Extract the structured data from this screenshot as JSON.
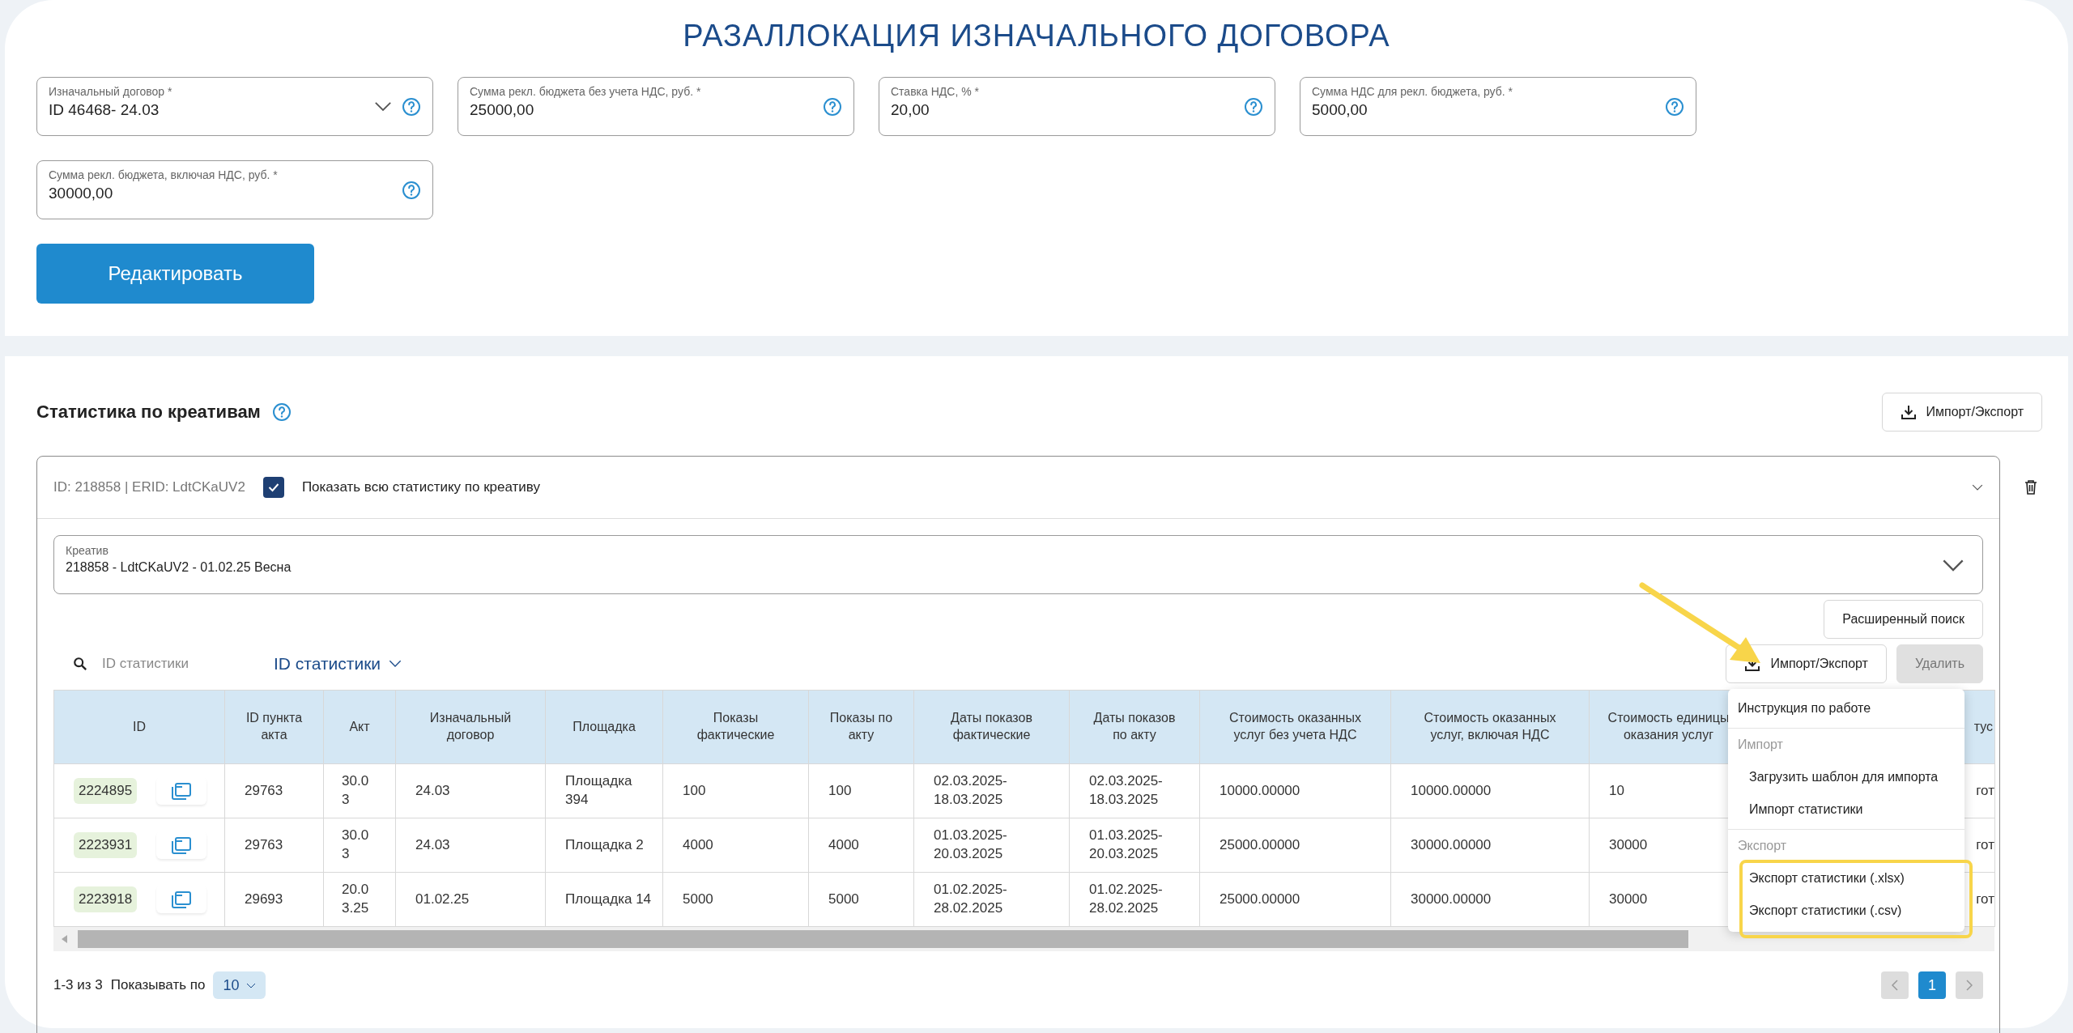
{
  "title": "РАЗАЛЛОКАЦИЯ ИЗНАЧАЛЬНОГО ДОГОВОРА",
  "form_fields": [
    {
      "kind": "select",
      "label": "Изначальный договор *",
      "value": "ID 46468- 24.03"
    },
    {
      "kind": "input",
      "label": "Сумма рекл. бюджета без учета НДС, руб. *",
      "value": "25000,00"
    },
    {
      "kind": "input",
      "label": "Ставка НДС, % *",
      "value": "20,00"
    },
    {
      "kind": "input",
      "label": "Сумма НДС для рекл. бюджета, руб. *",
      "value": "5000,00"
    },
    {
      "kind": "input",
      "label": "Сумма рекл. бюджета, включая НДС, руб. *",
      "value": "30000,00"
    }
  ],
  "edit_button": "Редактировать",
  "stats": {
    "title": "Статистика по креативам",
    "import_export_button": "Импорт/Экспорт",
    "panel": {
      "header": "ID: 218858 | ERID: LdtCKaUV2",
      "show_all": {
        "label": "Показать всю статистику по креативу",
        "checked": true
      },
      "creative_select": {
        "label": "Креатив",
        "value": "218858 - LdtCKaUV2 - 01.02.25 Весна"
      },
      "advanced_search_button": "Расширенный поиск",
      "search": {
        "placeholder": "ID статистики"
      },
      "search_by": "ID статистики",
      "import_export_button": "Импорт/Экспорт",
      "delete_button": {
        "label": "Удалить",
        "disabled": true
      },
      "table": {
        "columns": [
          "ID",
          "ID пункта акта",
          "Акт",
          "Изначальный договор",
          "Площадка",
          "Показы фактические",
          "Показы по акту",
          "Даты показов фактические",
          "Даты показов по акту",
          "Стоимость оказанных услуг без учета НДС",
          "Стоимость оказанных услуг, включая НДС",
          "Стоимость единицы оказания услуг",
          "тус"
        ],
        "rows": [
          {
            "cells": [
              "2224895",
              "29763",
              "30.03",
              "24.03",
              "Площадка 394",
              "100",
              "100",
              "02.03.2025-18.03.2025",
              "02.03.2025-18.03.2025",
              "10000.00000",
              "10000.00000",
              "10",
              "гот"
            ]
          },
          {
            "cells": [
              "2223931",
              "29763",
              "30.03",
              "24.03",
              "Площадка 2",
              "4000",
              "4000",
              "01.03.2025-20.03.2025",
              "01.03.2025-20.03.2025",
              "25000.00000",
              "30000.00000",
              "30000",
              "гот"
            ]
          },
          {
            "cells": [
              "2223918",
              "29693",
              "20.03.25",
              "01.02.25",
              "Площадка 14",
              "5000",
              "5000",
              "01.02.2025-28.02.2025",
              "01.02.2025-28.02.2025",
              "25000.00000",
              "30000.00000",
              "30000",
              "гот"
            ]
          }
        ]
      },
      "menu": [
        {
          "kind": "item",
          "label": "Инструкция по работе"
        },
        {
          "kind": "heading",
          "label": "Импорт"
        },
        {
          "kind": "subitem",
          "label": "Загрузить шаблон для импорта"
        },
        {
          "kind": "subitem",
          "label": "Импорт статистики"
        },
        {
          "kind": "heading",
          "label": "Экспорт"
        },
        {
          "kind": "subitem",
          "label": "Экспорт статистики (.xlsx)"
        },
        {
          "kind": "subitem",
          "label": "Экспорт статистики (.csv)"
        }
      ],
      "pagination": {
        "range": "1-3 из 3",
        "page_size_label": "Показывать по",
        "page_size": "10",
        "pages": [
          {
            "label": "1",
            "selected": true
          }
        ]
      }
    }
  }
}
